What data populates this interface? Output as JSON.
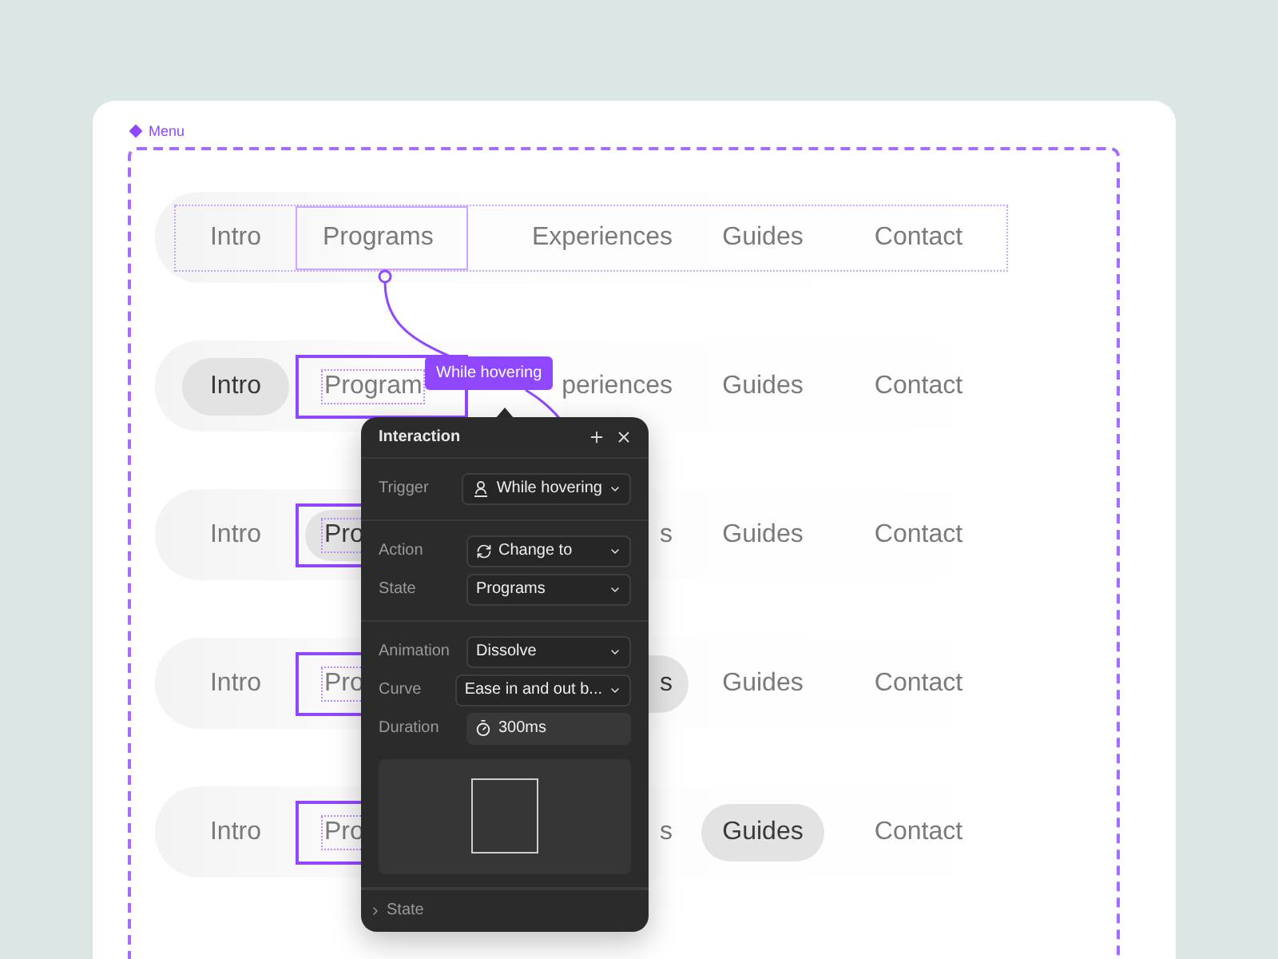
{
  "frame": {
    "label": "Menu"
  },
  "rows": [
    {
      "group_outline": true,
      "items": [
        {
          "text": "Intro",
          "selected": false,
          "outlined": false
        },
        {
          "text": "Programs",
          "selected": false,
          "outlined": true
        },
        {
          "text": "Experiences",
          "selected": false,
          "outlined": false
        },
        {
          "text": "Guides",
          "selected": false,
          "outlined": false
        },
        {
          "text": "Contact",
          "selected": false,
          "outlined": false
        }
      ]
    },
    {
      "group_outline": false,
      "items": [
        {
          "text": "Intro",
          "selected": true,
          "outlined": false
        },
        {
          "text": "Program",
          "selected": false,
          "outlined": true
        },
        {
          "text": "periences",
          "selected": false,
          "outlined": false
        },
        {
          "text": "Guides",
          "selected": false,
          "outlined": false
        },
        {
          "text": "Contact",
          "selected": false,
          "outlined": false
        }
      ]
    },
    {
      "group_outline": false,
      "items": [
        {
          "text": "Intro",
          "selected": false,
          "outlined": false
        },
        {
          "text": "Pro",
          "selected": true,
          "outlined": true
        },
        {
          "text": "s",
          "selected": false,
          "outlined": false
        },
        {
          "text": "Guides",
          "selected": false,
          "outlined": false
        },
        {
          "text": "Contact",
          "selected": false,
          "outlined": false
        }
      ]
    },
    {
      "group_outline": false,
      "items": [
        {
          "text": "Intro",
          "selected": false,
          "outlined": false
        },
        {
          "text": "Pro",
          "selected": false,
          "outlined": true
        },
        {
          "text": "s",
          "selected": true,
          "outlined": false
        },
        {
          "text": "Guides",
          "selected": false,
          "outlined": false
        },
        {
          "text": "Contact",
          "selected": false,
          "outlined": false
        }
      ]
    },
    {
      "group_outline": false,
      "items": [
        {
          "text": "Intro",
          "selected": false,
          "outlined": false
        },
        {
          "text": "Pro",
          "selected": false,
          "outlined": true
        },
        {
          "text": "s",
          "selected": false,
          "outlined": false
        },
        {
          "text": "Guides",
          "selected": true,
          "outlined": false
        },
        {
          "text": "Contact",
          "selected": false,
          "outlined": false
        }
      ]
    }
  ],
  "tag": {
    "label": "While hovering"
  },
  "popup": {
    "title": "Interaction",
    "sections": [
      {
        "fields": [
          {
            "kind": "trigger",
            "label": "Trigger",
            "value": "While hovering"
          }
        ]
      },
      {
        "fields": [
          {
            "kind": "action",
            "label": "Action",
            "value": "Change to"
          },
          {
            "kind": "target",
            "label": "State",
            "value": "Programs"
          }
        ]
      },
      {
        "fields": [
          {
            "kind": "animation",
            "label": "Animation",
            "value": "Dissolve"
          },
          {
            "kind": "curve",
            "label": "Curve",
            "value": "Ease in and out b..."
          },
          {
            "kind": "duration",
            "label": "Duration",
            "value": "300ms"
          }
        ]
      }
    ],
    "footer": {
      "label": "State",
      "expanded": false
    }
  }
}
